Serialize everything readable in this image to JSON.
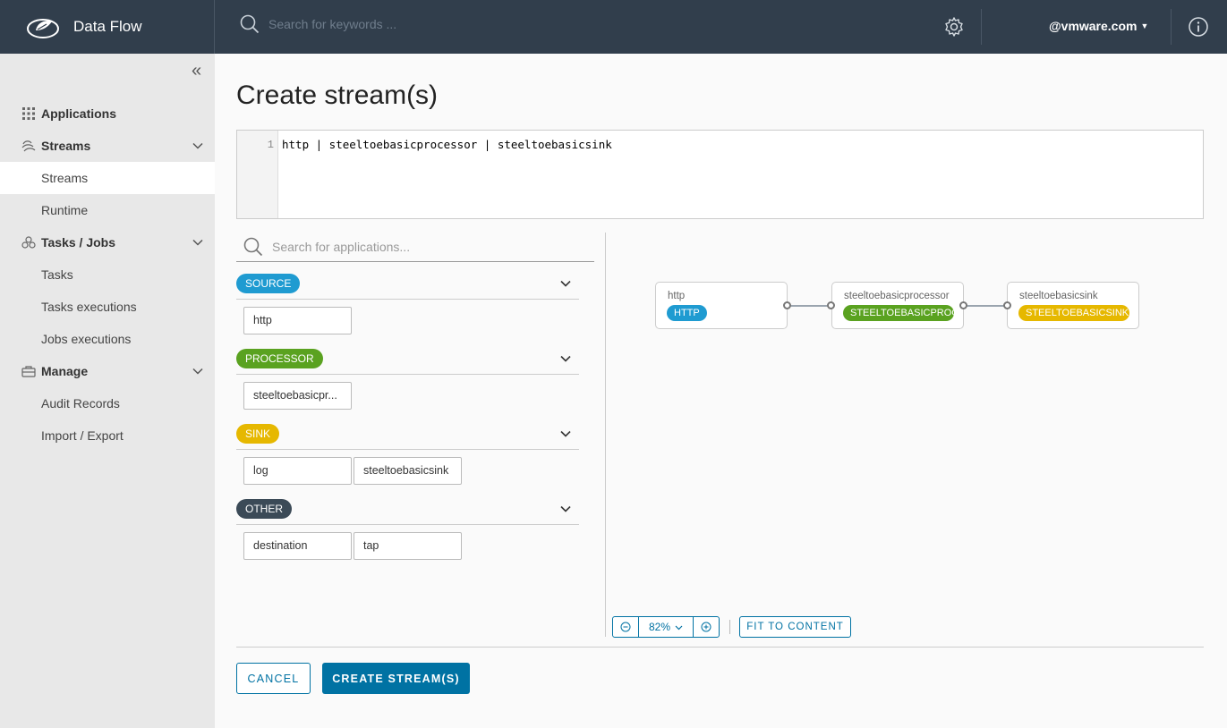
{
  "header": {
    "title": "Data Flow",
    "search_placeholder": "Search for keywords ...",
    "user": "@vmware.com",
    "icons": [
      "spring-logo-icon",
      "search-icon",
      "gear-icon",
      "chevron-down-icon",
      "info-icon"
    ]
  },
  "sidebar": {
    "groups": [
      {
        "label": "Applications",
        "icon": "grid-icon"
      },
      {
        "label": "Streams",
        "icon": "streams-icon",
        "items": [
          "Streams",
          "Runtime"
        ]
      },
      {
        "label": "Tasks / Jobs",
        "icon": "tasks-icon",
        "items": [
          "Tasks",
          "Tasks executions",
          "Jobs executions"
        ]
      },
      {
        "label": "Manage",
        "icon": "briefcase-icon",
        "items": [
          "Audit Records",
          "Import / Export"
        ]
      }
    ],
    "active_item": "Streams"
  },
  "main": {
    "title": "Create stream(s)",
    "editor": {
      "line_number": "1",
      "code": "http | steeltoebasicprocessor | steeltoebasicsink"
    },
    "palette": {
      "search_placeholder": "Search for applications...",
      "categories": [
        {
          "label": "SOURCE",
          "color": "#1f9bd1",
          "apps": [
            "http"
          ]
        },
        {
          "label": "PROCESSOR",
          "color": "#5aa220",
          "apps": [
            "steeltoebasicpr..."
          ]
        },
        {
          "label": "SINK",
          "color": "#e6b800",
          "apps": [
            "log",
            "steeltoebasicsink"
          ]
        },
        {
          "label": "OTHER",
          "color": "#3b4a57",
          "apps": [
            "destination",
            "tap"
          ]
        }
      ]
    },
    "canvas": {
      "nodes": [
        {
          "name": "http",
          "badge": "HTTP",
          "color": "#1f9bd1"
        },
        {
          "name": "steeltoebasicprocessor",
          "badge": "STEELTOEBASICPROC...",
          "color": "#5aa220"
        },
        {
          "name": "steeltoebasicsink",
          "badge": "STEELTOEBASICSINK",
          "color": "#e6b800"
        }
      ],
      "zoom_level": "82%",
      "fit_label": "FIT TO CONTENT"
    },
    "buttons": {
      "cancel": "CANCEL",
      "create": "CREATE STREAM(S)"
    }
  }
}
